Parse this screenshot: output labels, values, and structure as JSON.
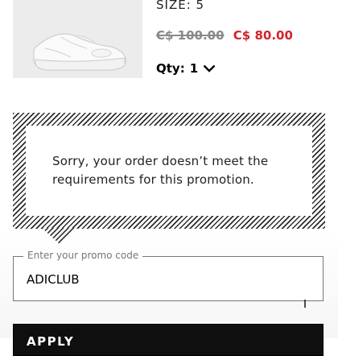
{
  "product": {
    "image_alt": "white sneaker",
    "size_label": "SIZE: 5",
    "price_original": "C$ 100.00",
    "price_sale": "C$ 80.00",
    "qty_label": "Qty:",
    "qty_value": "1",
    "qty_icon": "chevron-down-icon"
  },
  "promo_alert": {
    "message": "Sorry, your order doesn’t meet the requirements for this promotion."
  },
  "promo_input": {
    "label": "Enter your promo code",
    "value": "ADICLUB"
  },
  "apply_button": {
    "label": "APPLY"
  },
  "colors": {
    "sale_price": "#d3222a",
    "old_price": "#8a8a8a",
    "alert_stripes": "#2b2b2b",
    "button_bg": "#0f0f0f"
  }
}
